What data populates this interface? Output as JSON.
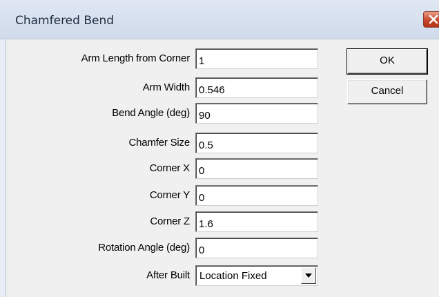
{
  "window": {
    "title": "Chamfered Bend"
  },
  "form": {
    "fields": [
      {
        "label": "Arm Length from Corner",
        "value": "1"
      },
      {
        "label": "Arm Width",
        "value": "0.546"
      },
      {
        "label": "Bend Angle (deg)",
        "value": "90"
      },
      {
        "label": "Chamfer Size",
        "value": "0.5"
      },
      {
        "label": "Corner X",
        "value": "0"
      },
      {
        "label": "Corner Y",
        "value": "0"
      },
      {
        "label": "Corner Z",
        "value": "1.6"
      },
      {
        "label": "Rotation Angle (deg)",
        "value": "0"
      }
    ],
    "after_built": {
      "label": "After Built",
      "value": "Location Fixed"
    }
  },
  "buttons": {
    "ok_label": "OK",
    "cancel_label": "Cancel"
  },
  "icons": {
    "close": "close-icon",
    "dropdown": "chevron-down-icon"
  },
  "colors": {
    "close_button": "#c8462a",
    "titlebar": "#cfdbec",
    "dialog_face": "#f0f0f0"
  }
}
